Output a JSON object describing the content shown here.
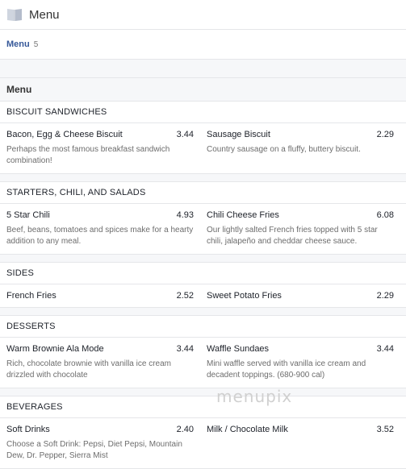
{
  "header": {
    "title": "Menu",
    "icon": "book-icon"
  },
  "tab": {
    "label": "Menu",
    "count": "5"
  },
  "menu_heading": "Menu",
  "sections": [
    {
      "title": "BISCUIT SANDWICHES",
      "items": [
        {
          "name": "Bacon, Egg & Cheese Biscuit",
          "price": "3.44",
          "desc": "Perhaps the most famous breakfast sandwich combination!"
        },
        {
          "name": "Sausage Biscuit",
          "price": "2.29",
          "desc": "Country sausage on a fluffy, buttery biscuit."
        }
      ]
    },
    {
      "title": "STARTERS, CHILI, AND SALADS",
      "items": [
        {
          "name": "5 Star Chili",
          "price": "4.93",
          "desc": "Beef, beans, tomatoes and spices make for a hearty addition to any meal."
        },
        {
          "name": "Chili Cheese Fries",
          "price": "6.08",
          "desc": "Our lightly salted French fries topped with 5 star chili, jalapeño and cheddar cheese sauce."
        }
      ]
    },
    {
      "title": "SIDES",
      "items": [
        {
          "name": "French Fries",
          "price": "2.52",
          "desc": ""
        },
        {
          "name": "Sweet Potato Fries",
          "price": "2.29",
          "desc": ""
        }
      ]
    },
    {
      "title": "DESSERTS",
      "items": [
        {
          "name": "Warm Brownie Ala Mode",
          "price": "3.44",
          "desc": "Rich, chocolate brownie with vanilla ice cream drizzled with chocolate"
        },
        {
          "name": "Waffle Sundaes",
          "price": "3.44",
          "desc": "Mini waffle served with vanilla ice cream and decadent toppings. (680-900 cal)"
        }
      ]
    },
    {
      "title": "BEVERAGES",
      "items": [
        {
          "name": "Soft Drinks",
          "price": "2.40",
          "desc": "Choose a Soft Drink: Pepsi, Diet Pepsi, Mountain Dew, Dr. Pepper, Sierra Mist"
        },
        {
          "name": "Milk / Chocolate Milk",
          "price": "3.52",
          "desc": ""
        }
      ]
    }
  ],
  "watermark": "menupix"
}
